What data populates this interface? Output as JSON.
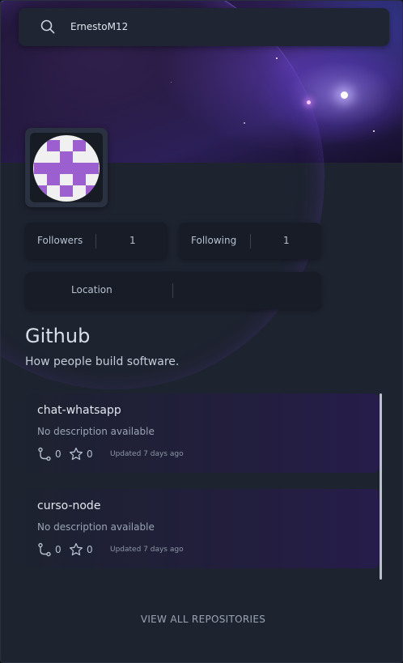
{
  "search": {
    "value": "ErnestoM12",
    "icon": "search-icon"
  },
  "profile": {
    "stats": [
      {
        "label": "Followers",
        "value": "1"
      },
      {
        "label": "Following",
        "value": "1"
      }
    ],
    "location": {
      "label": "Location",
      "value": ""
    }
  },
  "org": {
    "title": "Github",
    "description": "How people build software."
  },
  "repositories": [
    {
      "name": "chat-whatsapp",
      "description": "No description available",
      "forks": "0",
      "stars": "0",
      "updated": "Updated 7 days ago"
    },
    {
      "name": "curso-node",
      "description": "No description available",
      "forks": "0",
      "stars": "0",
      "updated": "Updated 7 days ago"
    }
  ],
  "footer": {
    "view_all_label": "VIEW ALL REPOSITORIES"
  },
  "colors": {
    "avatar_purple": "#9c5fcf",
    "accent": "#6a4fd0"
  }
}
